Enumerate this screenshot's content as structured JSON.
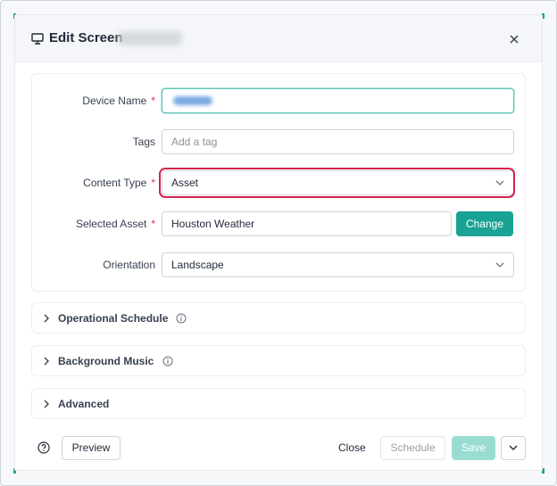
{
  "modal": {
    "title": "Edit Screen",
    "close_icon": "close-icon",
    "title_icon": "monitor-icon"
  },
  "form": {
    "device_name": {
      "label": "Device Name",
      "required_mark": "*"
    },
    "tags": {
      "label": "Tags",
      "placeholder": "Add a tag"
    },
    "content_type": {
      "label": "Content Type",
      "required_mark": "*",
      "value": "Asset"
    },
    "selected_asset": {
      "label": "Selected Asset",
      "required_mark": "*",
      "value": "Houston Weather",
      "change_label": "Change"
    },
    "orientation": {
      "label": "Orientation",
      "value": "Landscape"
    }
  },
  "sections": [
    {
      "label": "Operational Schedule",
      "has_info": true
    },
    {
      "label": "Background Music",
      "has_info": true
    },
    {
      "label": "Advanced",
      "has_info": false
    }
  ],
  "footer": {
    "help_icon": "help-circle-icon",
    "preview_label": "Preview",
    "close_label": "Close",
    "schedule_label": "Schedule",
    "save_label": "Save",
    "more_icon": "chevron-down-icon"
  },
  "colors": {
    "accent": "#1aa394",
    "accent_disabled": "#9adcd2",
    "highlight": "#d4234d",
    "required": "#dc2f52"
  }
}
